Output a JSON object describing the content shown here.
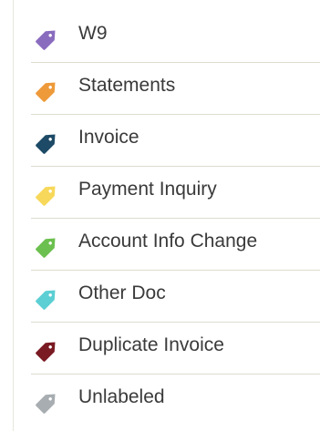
{
  "labels": [
    {
      "name": "W9",
      "color": "#8a6cbf",
      "icon": "tag-icon"
    },
    {
      "name": "Statements",
      "color": "#ee9a3a",
      "icon": "tag-icon"
    },
    {
      "name": "Invoice",
      "color": "#1d4a66",
      "icon": "tag-icon"
    },
    {
      "name": "Payment Inquiry",
      "color": "#f7d85a",
      "icon": "tag-icon"
    },
    {
      "name": "Account Info Change",
      "color": "#6cc04f",
      "icon": "tag-icon"
    },
    {
      "name": "Other Doc",
      "color": "#5ccfd4",
      "icon": "tag-icon"
    },
    {
      "name": "Duplicate Invoice",
      "color": "#7a1a22",
      "icon": "tag-icon"
    },
    {
      "name": "Unlabeled",
      "color": "#a7adb0",
      "icon": "tag-icon"
    }
  ]
}
